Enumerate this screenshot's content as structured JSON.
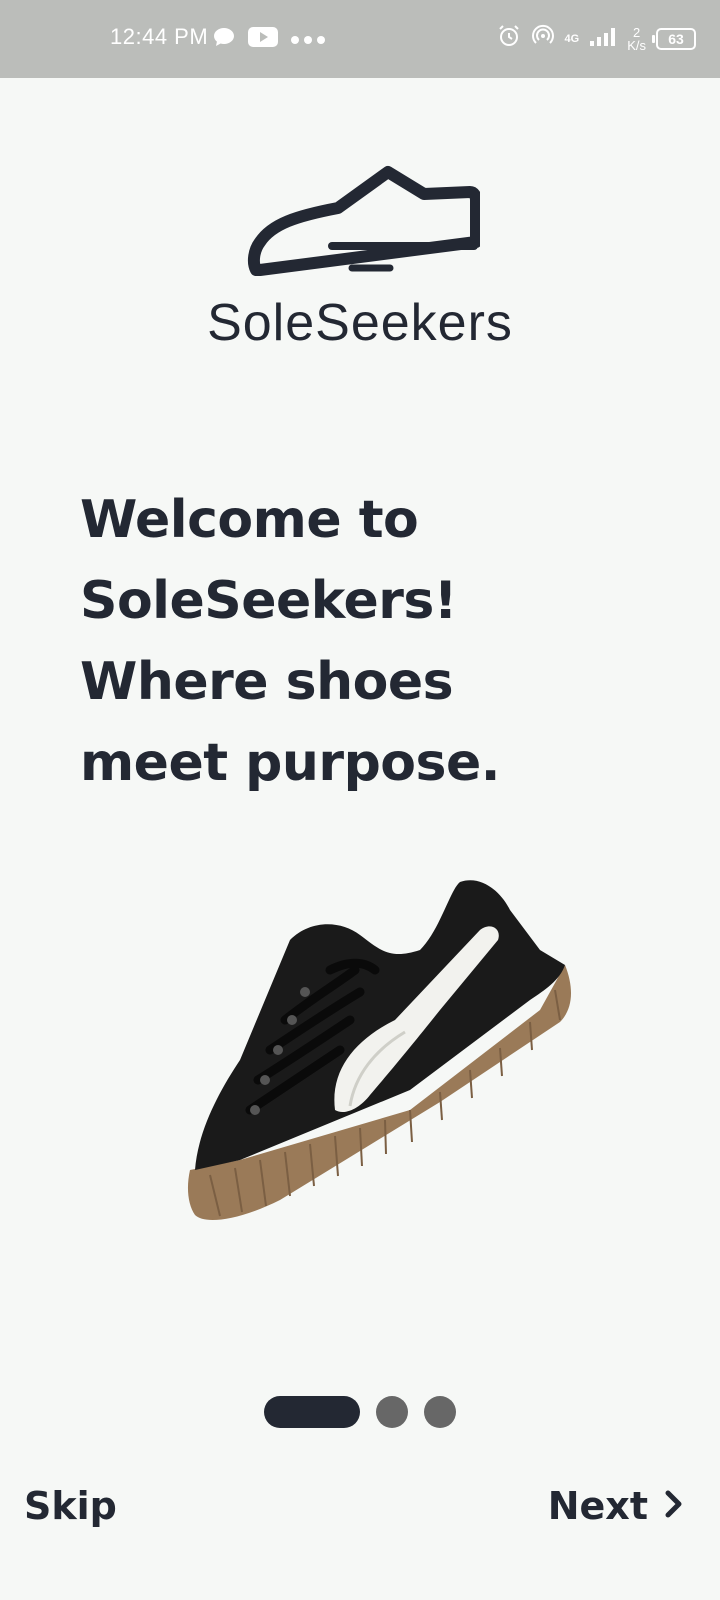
{
  "status_bar": {
    "time": "12:44 PM",
    "network_type": "4G",
    "net_speed_value": "2",
    "net_speed_unit": "K/s",
    "battery_level": "63"
  },
  "brand": {
    "name": "SoleSeekers",
    "logo_icon": "shoe-outline-icon"
  },
  "onboarding": {
    "headline_lines": [
      "Welcome to",
      "SoleSeekers!",
      "Where shoes",
      "meet purpose."
    ],
    "image_icon": "sneaker-image",
    "page_count": 3,
    "current_page": 1
  },
  "footer": {
    "skip_label": "Skip",
    "next_label": "Next",
    "next_icon": "chevron-right-icon"
  },
  "colors": {
    "primary": "#232833",
    "background": "#f6f8f6",
    "inactive_dot": "#676767",
    "status_bar": "#bbbdba"
  }
}
